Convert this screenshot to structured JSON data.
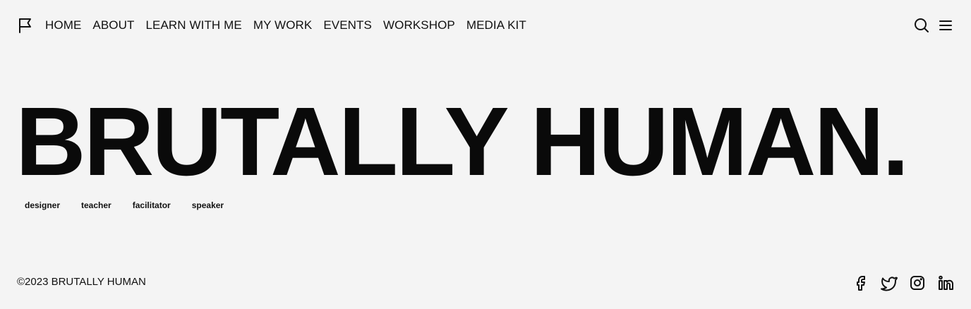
{
  "nav": {
    "items": [
      {
        "label": "HOME"
      },
      {
        "label": "ABOUT"
      },
      {
        "label": "LEARN WITH ME"
      },
      {
        "label": "MY WORK"
      },
      {
        "label": "EVENTS"
      },
      {
        "label": "WORKSHOP"
      },
      {
        "label": "MEDIA KIT"
      }
    ]
  },
  "icons": {
    "logo": "flag-icon",
    "search": "search-icon",
    "menu": "menu-icon",
    "facebook": "facebook-icon",
    "twitter": "twitter-icon",
    "instagram": "instagram-icon",
    "linkedin": "linkedin-icon"
  },
  "hero": {
    "title": "BRUTALLY HUMAN.",
    "tags": [
      "designer",
      "teacher",
      "facilitator",
      "speaker"
    ]
  },
  "footer": {
    "copyright": "©2023 BRUTALLY HUMAN"
  },
  "colors": {
    "background": "#f4f4f4",
    "text": "#111111"
  }
}
